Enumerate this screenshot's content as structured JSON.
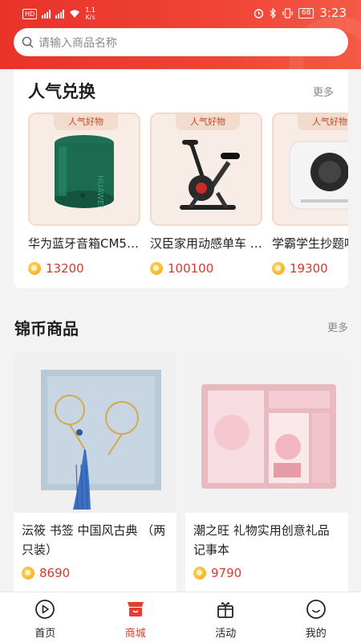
{
  "status": {
    "speed": "1.1",
    "speed_unit": "K/s",
    "battery": "68",
    "time": "3:23"
  },
  "search": {
    "placeholder": "请输入商品名称"
  },
  "popular": {
    "title": "人气兑换",
    "more": "更多",
    "items": [
      {
        "tag": "人气好物",
        "name": "华为蓝牙音箱CM5…",
        "price": "13200"
      },
      {
        "tag": "人气好物",
        "name": "汉臣家用动感单车 …",
        "price": "100100"
      },
      {
        "tag": "人气好物",
        "name": "学霸学生抄题吧",
        "price": "19300"
      }
    ]
  },
  "coins": {
    "title": "锦币商品",
    "more": "更多",
    "items": [
      {
        "name": "沄筱 书签 中国风古典 （两只装）",
        "price": "8690"
      },
      {
        "name": " 潮之旺 礼物实用创意礼品记事本",
        "price": "9790"
      }
    ]
  },
  "tabs": [
    {
      "label": "首页",
      "icon": "play-circle-icon"
    },
    {
      "label": "商城",
      "icon": "store-icon"
    },
    {
      "label": "活动",
      "icon": "gift-icon"
    },
    {
      "label": "我的",
      "icon": "smile-icon"
    }
  ],
  "colors": {
    "brand_red": "#e8332b",
    "price_red": "#d43a2a",
    "tag_bg": "#f1dccd"
  }
}
